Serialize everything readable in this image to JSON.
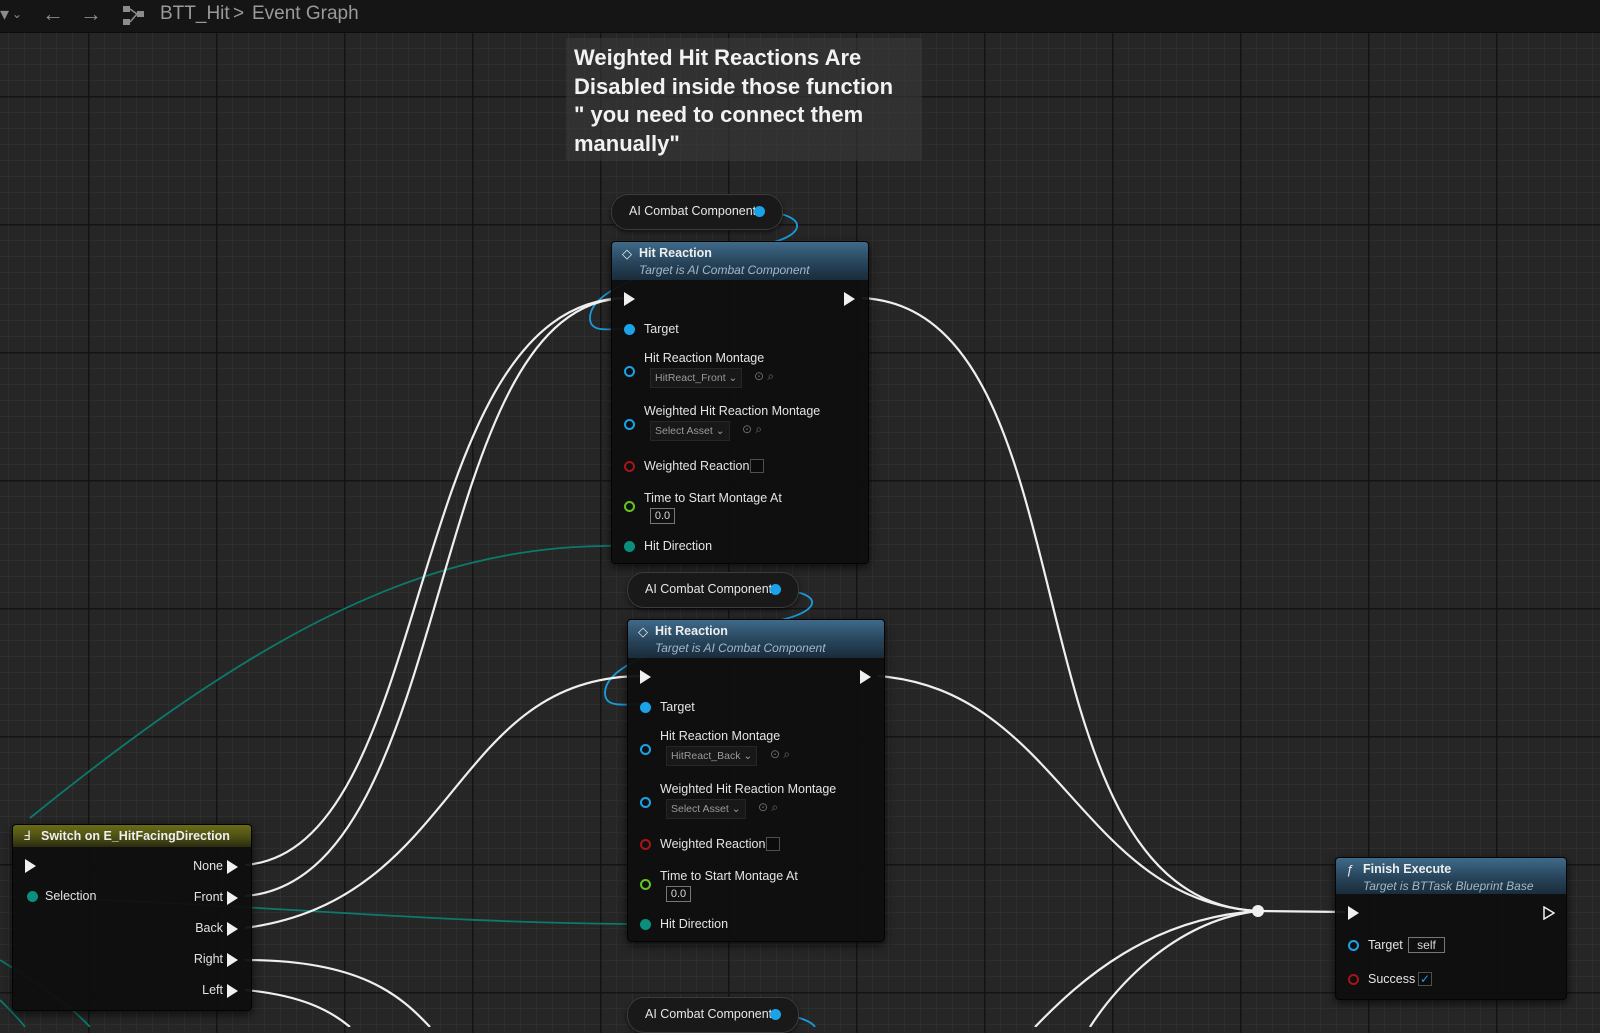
{
  "toolbar": {
    "menu_glyph": "▾",
    "back_icon": "←",
    "forward_icon": "→",
    "graph_icon": "graph-nodes",
    "breadcrumb": [
      "BTT_Hit",
      "Event Graph"
    ],
    "separator": ">"
  },
  "comment": {
    "text": "Weighted Hit Reactions Are\nDisabled inside those function\n\" you need to connect them\nmanually\""
  },
  "getters": [
    {
      "label": "AI Combat Component"
    },
    {
      "label": "AI Combat Component"
    },
    {
      "label": "AI Combat Component"
    }
  ],
  "hit_reaction_nodes": [
    {
      "title": "Hit Reaction",
      "subtitle": "Target is AI Combat Component",
      "target_label": "Target",
      "montage_label": "Hit Reaction Montage",
      "montage_value": "HitReact_Front",
      "weighted_montage_label": "Weighted Hit Reaction Montage",
      "weighted_montage_value": "Select Asset",
      "weighted_reaction_label": "Weighted Reaction",
      "weighted_reaction_checked": false,
      "time_label": "Time to Start Montage At",
      "time_value": "0.0",
      "direction_label": "Hit Direction"
    },
    {
      "title": "Hit Reaction",
      "subtitle": "Target is AI Combat Component",
      "target_label": "Target",
      "montage_label": "Hit Reaction Montage",
      "montage_value": "HitReact_Back",
      "weighted_montage_label": "Weighted Hit Reaction Montage",
      "weighted_montage_value": "Select Asset",
      "weighted_reaction_label": "Weighted Reaction",
      "weighted_reaction_checked": false,
      "time_label": "Time to Start Montage At",
      "time_value": "0.0",
      "direction_label": "Hit Direction"
    }
  ],
  "switch_node": {
    "title": "Switch on E_HitFacingDirection",
    "selection_label": "Selection",
    "outputs": [
      "None",
      "Front",
      "Back",
      "Right",
      "Left"
    ]
  },
  "finish_node": {
    "title": "Finish Execute",
    "subtitle": "Target is BTTask Blueprint Base",
    "target_label": "Target",
    "target_value": "self",
    "success_label": "Success",
    "success_checked": true
  },
  "colors": {
    "object_pin": "#1aa3e8",
    "bool_pin": "#a5151a",
    "float_pin": "#63c522",
    "enum_pin": "#0b8f7d",
    "function_header": "#3f6a8a",
    "switch_header": "#6a6c18"
  }
}
